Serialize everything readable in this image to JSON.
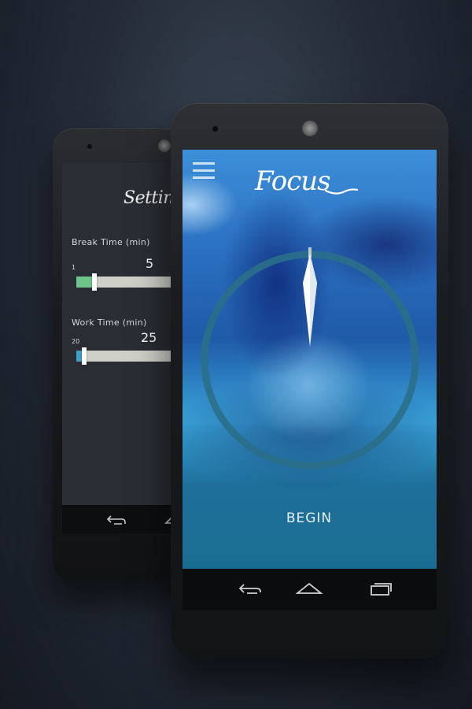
{
  "settings_screen": {
    "title": "Settings",
    "break_time": {
      "label": "Break Time (min)",
      "min_label": "1",
      "value": "5",
      "fill_color": "#6fc48a"
    },
    "work_time": {
      "label": "Work Time (min)",
      "min_label": "20",
      "value": "25",
      "fill_color": "#3fa0c8"
    }
  },
  "focus_screen": {
    "title": "Focus",
    "begin_label": "BEGIN",
    "ring_color": "#2a6f8a",
    "needle_color": "#ffffff"
  },
  "navbar": {
    "icons": [
      "back-icon",
      "home-icon",
      "recent-apps-icon"
    ]
  }
}
